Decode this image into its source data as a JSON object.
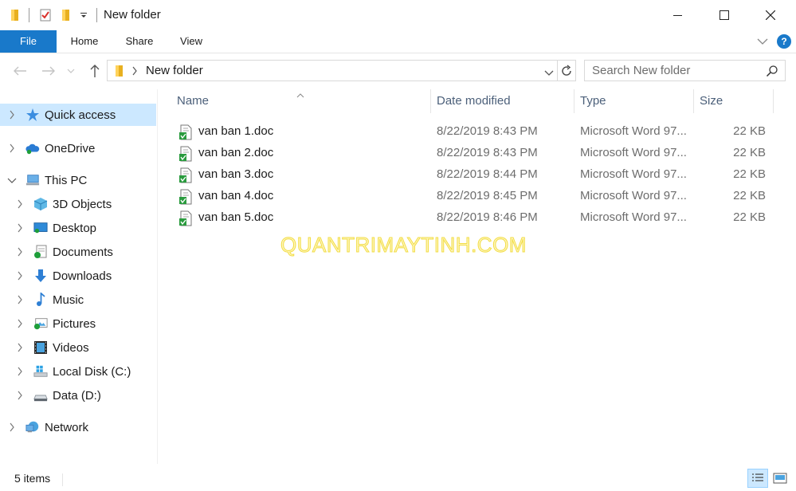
{
  "window": {
    "title": "New folder",
    "quick_access_toolbar": [
      "folder-icon",
      "properties-icon",
      "new-folder-icon",
      "customize-dropdown"
    ]
  },
  "ribbon": {
    "tabs": [
      {
        "label": "File",
        "active": true
      },
      {
        "label": "Home"
      },
      {
        "label": "Share"
      },
      {
        "label": "View"
      }
    ],
    "help_label": "?"
  },
  "address": {
    "path": [
      "New folder"
    ],
    "search_placeholder": "Search New folder"
  },
  "sidebar": {
    "items": [
      {
        "label": "Quick access",
        "icon": "star-icon",
        "selected": true
      },
      {
        "label": "OneDrive",
        "icon": "cloud-icon"
      },
      {
        "label": "This PC",
        "icon": "computer-icon",
        "expanded": true
      },
      {
        "label": "3D Objects",
        "icon": "cube-icon"
      },
      {
        "label": "Desktop",
        "icon": "desktop-icon"
      },
      {
        "label": "Documents",
        "icon": "documents-icon"
      },
      {
        "label": "Downloads",
        "icon": "download-icon"
      },
      {
        "label": "Music",
        "icon": "music-icon"
      },
      {
        "label": "Pictures",
        "icon": "pictures-icon"
      },
      {
        "label": "Videos",
        "icon": "videos-icon"
      },
      {
        "label": "Local Disk (C:)",
        "icon": "windows-drive-icon"
      },
      {
        "label": "Data (D:)",
        "icon": "drive-icon"
      },
      {
        "label": "Network",
        "icon": "network-icon"
      }
    ]
  },
  "columns": {
    "name": "Name",
    "date": "Date modified",
    "type": "Type",
    "size": "Size",
    "sorted_by": "name"
  },
  "files": [
    {
      "name": "van ban 1.doc",
      "date": "8/22/2019 8:43 PM",
      "type": "Microsoft Word 97...",
      "size": "22 KB"
    },
    {
      "name": "van ban 2.doc",
      "date": "8/22/2019 8:43 PM",
      "type": "Microsoft Word 97...",
      "size": "22 KB"
    },
    {
      "name": "van ban 3.doc",
      "date": "8/22/2019 8:44 PM",
      "type": "Microsoft Word 97...",
      "size": "22 KB"
    },
    {
      "name": "van ban 4.doc",
      "date": "8/22/2019 8:45 PM",
      "type": "Microsoft Word 97...",
      "size": "22 KB"
    },
    {
      "name": "van ban 5.doc",
      "date": "8/22/2019 8:46 PM",
      "type": "Microsoft Word 97...",
      "size": "22 KB"
    }
  ],
  "watermark": "QUANTRIMAYTINH.COM",
  "status": {
    "items_count": "5 items"
  },
  "colors": {
    "accent": "#1979ca",
    "selection": "#cce8ff",
    "header_text": "#4c607a"
  }
}
